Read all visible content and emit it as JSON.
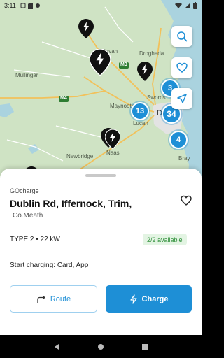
{
  "status": {
    "time": "3:11"
  },
  "map": {
    "places": [
      {
        "id": "drogheda",
        "label": "Drogheda"
      },
      {
        "id": "navan",
        "label": "Navan"
      },
      {
        "id": "mullingar",
        "label": "Mullingar"
      },
      {
        "id": "swords",
        "label": "Swords"
      },
      {
        "id": "maynooth",
        "label": "Maynooth"
      },
      {
        "id": "dublin",
        "label": "Dub"
      },
      {
        "id": "lucan",
        "label": "Lucan"
      },
      {
        "id": "naas",
        "label": "Naas"
      },
      {
        "id": "newbridge",
        "label": "Newbridge"
      },
      {
        "id": "bray",
        "label": "Bray"
      }
    ],
    "roads": {
      "m3": "M3",
      "m4": "M4"
    },
    "clusters": [
      {
        "id": "cluster-13",
        "count": "13"
      },
      {
        "id": "cluster-34",
        "count": "34"
      },
      {
        "id": "cluster-3",
        "count": "3"
      },
      {
        "id": "cluster-4",
        "count": "4"
      }
    ],
    "buttons": {
      "search": "search-icon",
      "favorites": "heart-icon",
      "locate": "navigation-arrow-icon"
    }
  },
  "station": {
    "operator": "GOcharge",
    "title": "Dublin Rd, Iffernock, Trim,",
    "subtitle": "Co.Meath",
    "connector": "TYPE 2 • 22 kW",
    "availability": "2/2 available",
    "payment": "Start charging: Card, App"
  },
  "actions": {
    "route": "Route",
    "charge": "Charge"
  },
  "colors": {
    "accent": "#1e8fd6",
    "available_bg": "#e3f4e3",
    "available_text": "#2f8f3a",
    "map_land": "#cfe3c4",
    "sea": "#aad3df"
  }
}
